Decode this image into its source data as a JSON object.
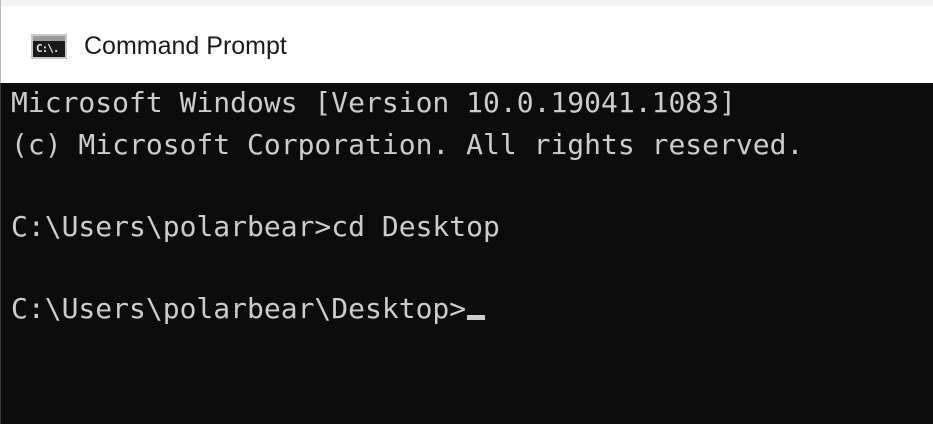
{
  "window": {
    "title": "Command Prompt",
    "icon": "cmd-app-icon",
    "icon_glyph": "C:\\."
  },
  "console": {
    "lines": [
      "Microsoft Windows [Version 10.0.19041.1083]",
      "(c) Microsoft Corporation. All rights reserved.",
      "C:\\Users\\polarbear>cd Desktop",
      "C:\\Users\\polarbear\\Desktop>"
    ],
    "text_color": "#cccccc",
    "background_color": "#0c0c0c"
  }
}
